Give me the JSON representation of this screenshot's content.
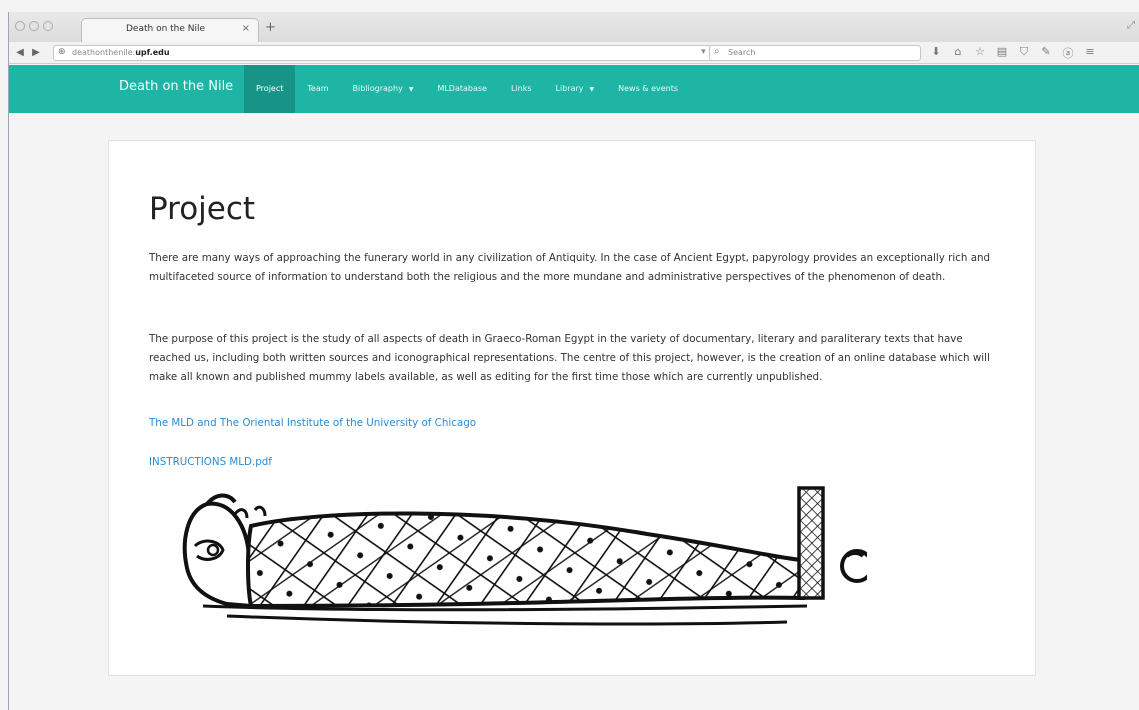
{
  "browser": {
    "tab_title": "Death on the Nile",
    "tab_close": "×",
    "new_tab": "+",
    "url_prefix": "deathonthenile.",
    "url_domain": "upf.edu",
    "search_placeholder": "Search",
    "icons": [
      "back-icon",
      "forward-icon",
      "globe-icon",
      "reload-icon",
      "search-icon",
      "download-icon",
      "home-icon",
      "bookmark-star-icon",
      "library-icon",
      "pocket-icon",
      "menu-icon"
    ]
  },
  "site": {
    "brand": "Death on the Nile",
    "menu": [
      {
        "label": "Project",
        "active": true
      },
      {
        "label": "Team"
      },
      {
        "label": "Bibliography",
        "dropdown": true
      },
      {
        "label": "MLDatabase"
      },
      {
        "label": "Links"
      },
      {
        "label": "Library",
        "dropdown": true
      },
      {
        "label": "News & events"
      }
    ],
    "accent_color": "#1fb5a5"
  },
  "content": {
    "title": "Project",
    "paragraph1": "There are many ways of approaching the funerary world in any civilization of Antiquity. In the case of Ancient Egypt, papyrology provides an exceptionally rich and multifaceted source of information to understand both the religious and the more mundane and administrative perspectives of the phenomenon of death.",
    "paragraph2": "The purpose of this project is the study of all aspects of death in Graeco-Roman Egypt in the variety of documentary, literary and paraliterary texts that have reached us, including both written sources and iconographical representations. The centre of this project, however, is the creation of an online database which will make all known and published mummy labels available, as well as editing for the first time those which are currently unpublished.",
    "link1": "The MLD and The Oriental Institute of the University of Chicago",
    "link2": "INSTRUCTIONS MLD.pdf",
    "link_color": "#2a8bd6"
  }
}
